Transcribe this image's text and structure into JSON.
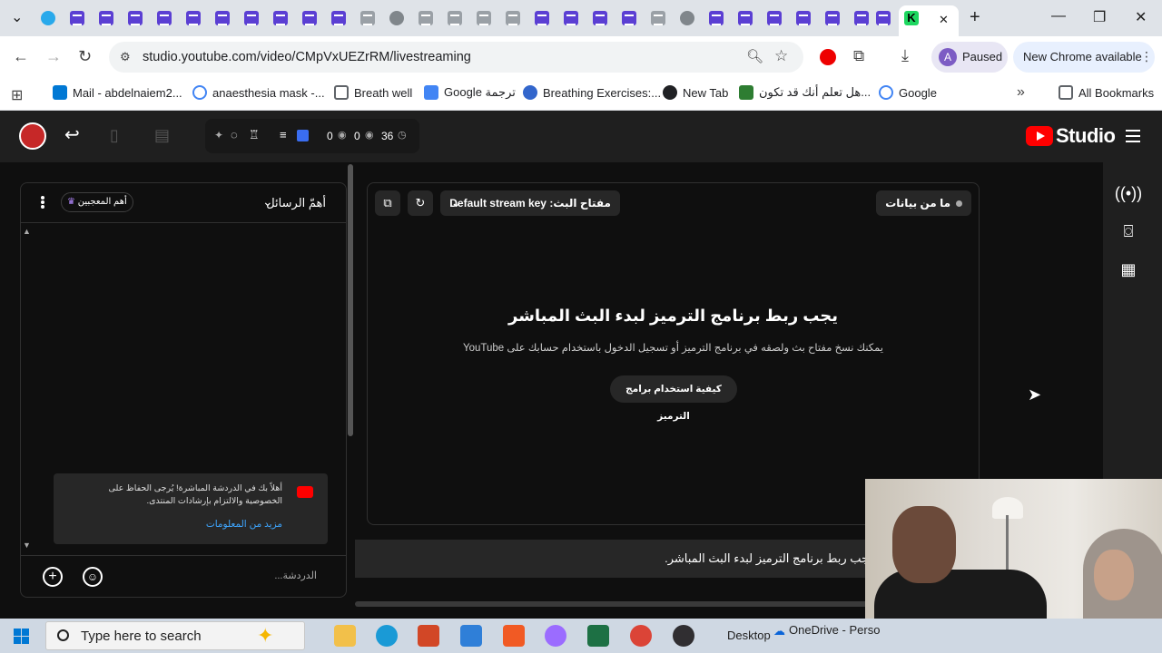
{
  "browser": {
    "active_tab_close": "✕",
    "new_tab": "+",
    "url": "studio.youtube.com/video/CMpVxUEZrRM/livestreaming",
    "profile_initial": "A",
    "profile_status": "Paused",
    "update_label": "New Chrome available",
    "bookmarks": [
      {
        "label": "Mail - abdelnaiem2...",
        "color": "#0078d4"
      },
      {
        "label": "anaesthesia mask -...",
        "color": "#4285f4"
      },
      {
        "label": "Breath well",
        "color": "#5f6368"
      },
      {
        "label": "Google ترجمة",
        "color": "#4285f4"
      },
      {
        "label": "Breathing Exercises:...",
        "color": "#3366cc"
      },
      {
        "label": "New Tab",
        "color": "#202124"
      },
      {
        "label": "هل تعلم أنك قد تكون...",
        "color": "#2e7d32"
      },
      {
        "label": "Google",
        "color": "#4285f4"
      }
    ],
    "all_bookmarks": "All Bookmarks",
    "more_bookmarks": "»"
  },
  "studio": {
    "stats": {
      "likes": "0",
      "viewers": "0",
      "duration": "36"
    },
    "logo_word": "Studio",
    "chat": {
      "title": "أهمّ الرسائل",
      "top_fans": "أهم المعجبين",
      "welcome_text": "أهلاً بك في الدردشة المباشرة! يُرجى الحفاظ على الخصوصية والالتزام بإرشادات المنتدى.",
      "learn_more": "مزيد من المعلومات",
      "placeholder": "الدردشة..."
    },
    "preview": {
      "stream_key_label": "مفتاح البث: Default stream key",
      "no_data": "ما من بيانات",
      "title": "يجب ربط برنامج الترميز لبدء البث المباشر",
      "subtitle": "يمكنك نسخ مفتاح بث ولصقه في برنامج الترميز أو تسجيل الدخول باستخدام حسابك على YouTube",
      "help_button": "كيفية استخدام برامج الترميز"
    },
    "status_message": "يجب ربط برنامج الترميز لبدء البث المباشر."
  },
  "taskbar": {
    "search_placeholder": "Type here to search",
    "desktop_label": "Desktop",
    "onedrive_label": "OneDrive - Perso"
  }
}
